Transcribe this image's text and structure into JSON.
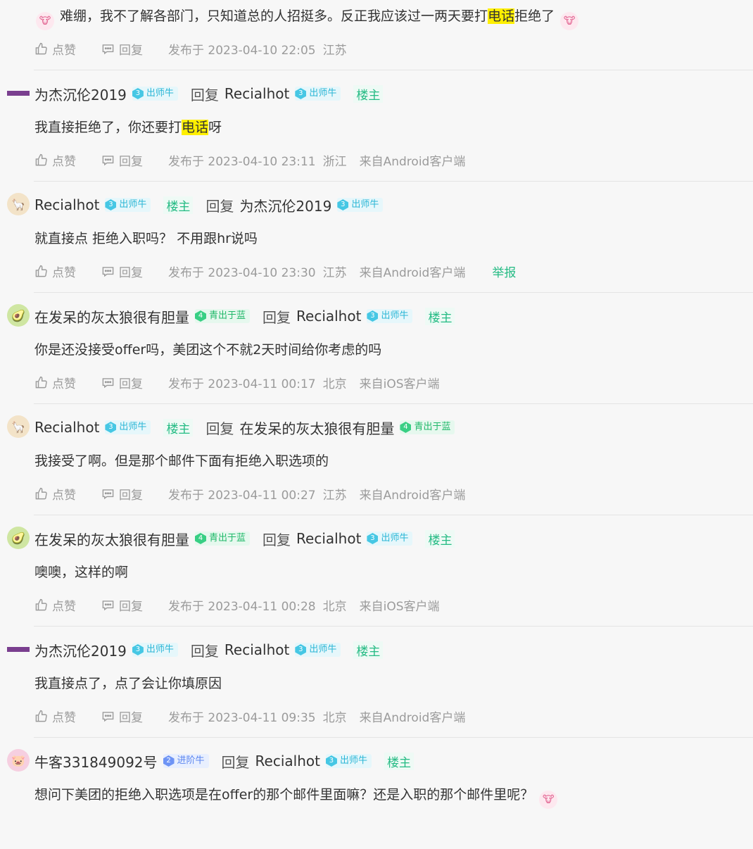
{
  "labels": {
    "like": "点赞",
    "reply": "回复",
    "reply_to": "回复",
    "published_prefix": "发布于",
    "owner": "楼主",
    "report": "举报"
  },
  "colors": {
    "background": "#f7f7f7",
    "accent_green": "#25bb84",
    "highlight": "#ffef00",
    "meta_gray": "#9b9b9b"
  },
  "replies": [
    {
      "content_pre": "难绷，我不了解各部门，只知道总的人招挺多。反正我应该过一两天要打",
      "content_hl": "电话",
      "content_post": "拒绝了",
      "time": "2023-04-10 22:05",
      "location": "江苏",
      "client": ""
    },
    {
      "author": "为杰沉伦2019",
      "author_level": "3",
      "author_badge": "出师牛",
      "target": "Recialhot",
      "target_level": "3",
      "target_badge": "出师牛",
      "content_pre": "我直接拒绝了，你还要打",
      "content_hl": "电话",
      "content_post": "呀",
      "time": "2023-04-10 23:11",
      "location": "浙江",
      "client": "来自Android客户端"
    },
    {
      "author": "Recialhot",
      "author_level": "3",
      "author_badge": "出师牛",
      "target": "为杰沉伦2019",
      "target_level": "3",
      "target_badge": "出师牛",
      "content": "就直接点 拒绝入职吗？ 不用跟hr说吗",
      "time": "2023-04-10 23:30",
      "location": "江苏",
      "client": "来自Android客户端"
    },
    {
      "author": "在发呆的灰太狼很有胆量",
      "author_level": "4",
      "author_badge": "青出于蓝",
      "target": "Recialhot",
      "target_level": "3",
      "target_badge": "出师牛",
      "content": "你是还没接受offer吗，美团这个不就2天时间给你考虑的吗",
      "time": "2023-04-11 00:17",
      "location": "北京",
      "client": "来自iOS客户端"
    },
    {
      "author": "Recialhot",
      "author_level": "3",
      "author_badge": "出师牛",
      "target": "在发呆的灰太狼很有胆量",
      "target_level": "4",
      "target_badge": "青出于蓝",
      "content": "我接受了啊。但是那个邮件下面有拒绝入职选项的",
      "time": "2023-04-11 00:27",
      "location": "江苏",
      "client": "来自Android客户端"
    },
    {
      "author": "在发呆的灰太狼很有胆量",
      "author_level": "4",
      "author_badge": "青出于蓝",
      "target": "Recialhot",
      "target_level": "3",
      "target_badge": "出师牛",
      "content": "噢噢，这样的啊",
      "time": "2023-04-11 00:28",
      "location": "北京",
      "client": "来自iOS客户端"
    },
    {
      "author": "为杰沉伦2019",
      "author_level": "3",
      "author_badge": "出师牛",
      "target": "Recialhot",
      "target_level": "3",
      "target_badge": "出师牛",
      "content": "我直接点了，点了会让你填原因",
      "time": "2023-04-11 09:35",
      "location": "北京",
      "client": "来自Android客户端"
    },
    {
      "author": "牛客331849092号",
      "author_level": "2",
      "author_badge": "进阶牛",
      "target": "Recialhot",
      "target_level": "3",
      "target_badge": "出师牛",
      "content": "想问下美团的拒绝入职选项是在offer的那个邮件里面嘛？还是入职的那个邮件里呢？"
    }
  ]
}
